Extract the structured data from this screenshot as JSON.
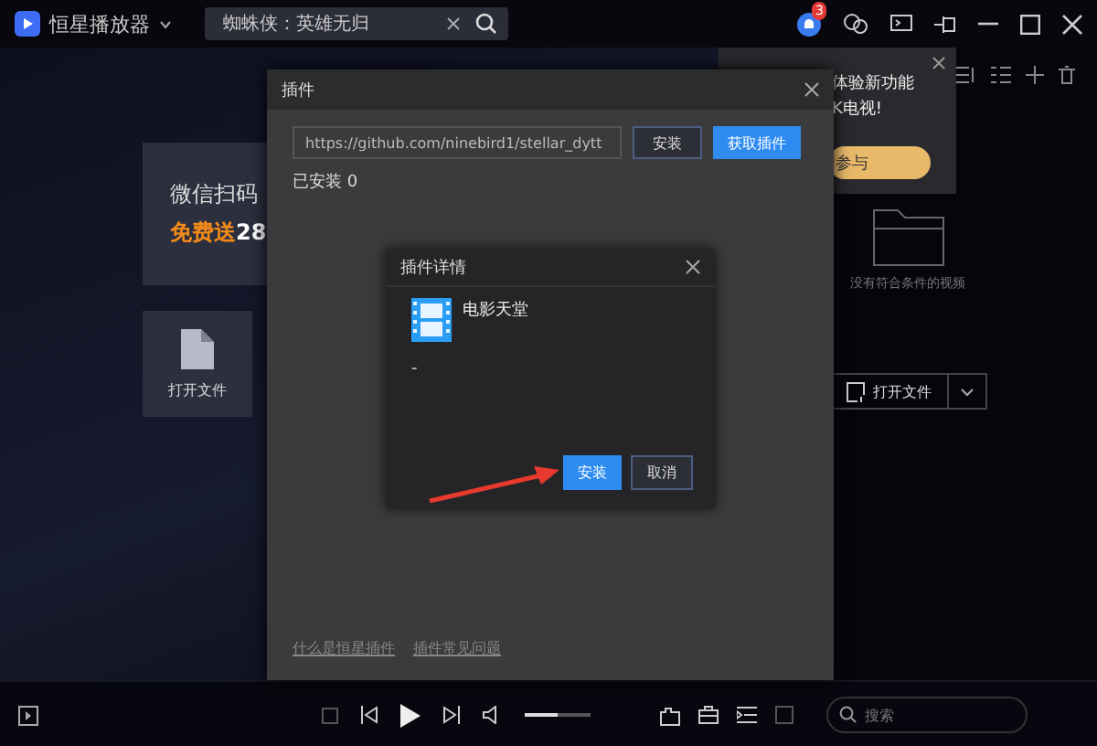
{
  "app": {
    "title": "恒星播放器",
    "search_value": "蜘蛛侠：英雄无归",
    "notification_count": "3"
  },
  "banner": {
    "line1": "微信扫码",
    "line2_highlight": "免费送",
    "line2_rest": "28"
  },
  "open_file_tile": {
    "label": "打开文件"
  },
  "notice": {
    "line1": "体验新功能",
    "line2": "K电视!",
    "button": "参与"
  },
  "right_panel": {
    "empty_text": "没有符合条件的视频",
    "open_button": "打开文件"
  },
  "plugin_dialog": {
    "title": "插件",
    "url_value": "https://github.com/ninebird1/stellar_dytt",
    "install_button": "安装",
    "get_button": "获取插件",
    "installed": "已安装 0",
    "links": [
      "什么是恒星插件",
      "插件常见问题"
    ]
  },
  "details_dialog": {
    "title": "插件详情",
    "name": "电影天堂",
    "description": "-",
    "install_button": "安装",
    "cancel_button": "取消"
  },
  "player": {
    "volume": {
      "level": 0.5
    },
    "search": {
      "placeholder": "搜索"
    }
  }
}
